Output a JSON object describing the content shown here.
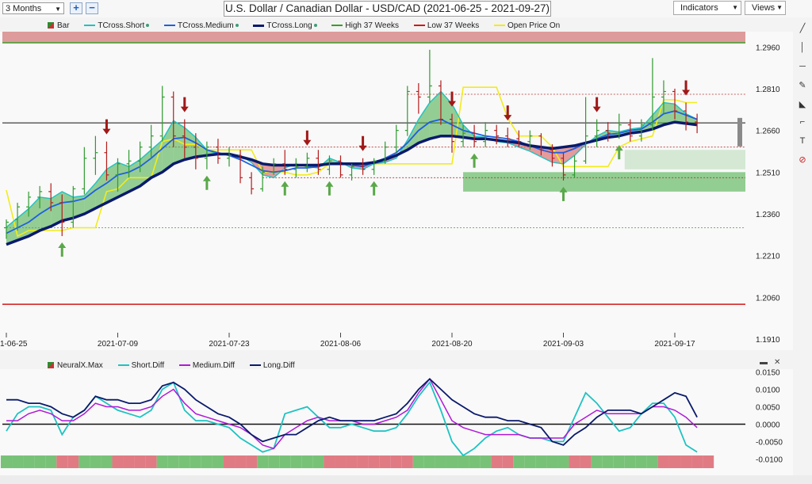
{
  "toolbar": {
    "period": "3 Months",
    "zoom_in": "+",
    "zoom_out": "−",
    "title": "U.S. Dollar / Canadian Dollar - USD/CAD (2021-06-25 - 2021-09-27)",
    "indicators": "Indicators",
    "views": "Views"
  },
  "legend_top": {
    "bar": "Bar",
    "tcross_short": "TCross.Short",
    "tcross_medium": "TCross.Medium",
    "tcross_long": "TCross.Long",
    "high": "High 37 Weeks",
    "low": "Low 37 Weeks",
    "open": "Open Price On"
  },
  "legend_bottom": {
    "neuralx": "NeuralX.Max",
    "short": "Short.Diff",
    "medium": "Medium.Diff",
    "long": "Long.Diff"
  },
  "colors": {
    "tcross_short": "#1fc2c2",
    "tcross_medium": "#1f5fe0",
    "tcross_long": "#0a1a6b",
    "high": "#3a9e2a",
    "low": "#d01818",
    "open": "#f2ec1a",
    "up_bar": "#2f9a2f",
    "down_bar": "#b51c1c",
    "medium_diff": "#b018d8"
  },
  "chart_data": [
    {
      "type": "line",
      "title": "U.S. Dollar / Canadian Dollar - USD/CAD (2021-06-25 - 2021-09-27)",
      "x_tick_labels": [
        "1-06-25",
        "2021-07-09",
        "2021-07-23",
        "2021-08-06",
        "2021-08-20",
        "2021-09-03",
        "2021-09-17"
      ],
      "x_tick_index": [
        0,
        10,
        20,
        30,
        40,
        50,
        60
      ],
      "y_ticks": [
        1.296,
        1.281,
        1.266,
        1.251,
        1.236,
        1.221,
        1.206,
        1.191
      ],
      "y_tick_labels": [
        "1.2960",
        "1.2810",
        "1.2660",
        "1.2510",
        "1.2360",
        "1.2210",
        "1.2060",
        "1.1910"
      ],
      "ylim": [
        1.187,
        1.3015
      ],
      "high_37_weeks": 1.2975,
      "low_37_weeks": 1.2035,
      "last_price": 1.2687,
      "series": [
        {
          "name": "TCross.Short",
          "values": [
            1.2312,
            1.2345,
            1.2378,
            1.242,
            1.2415,
            1.244,
            1.242,
            1.2425,
            1.247,
            1.252,
            1.2545,
            1.253,
            1.2555,
            1.259,
            1.2625,
            1.2695,
            1.267,
            1.2635,
            1.259,
            1.2575,
            1.2575,
            1.257,
            1.2545,
            1.25,
            1.249,
            1.2525,
            1.254,
            1.253,
            1.2525,
            1.256,
            1.2545,
            1.2525,
            1.252,
            1.254,
            1.2545,
            1.256,
            1.2625,
            1.27,
            1.276,
            1.28,
            1.2755,
            1.268,
            1.264,
            1.2635,
            1.262,
            1.2615,
            1.26,
            1.2585,
            1.2565,
            1.2545,
            1.254,
            1.257,
            1.261,
            1.264,
            1.266,
            1.2655,
            1.2665,
            1.267,
            1.2715,
            1.276,
            1.2755,
            1.272,
            1.27
          ]
        },
        {
          "name": "TCross.Medium",
          "values": [
            1.229,
            1.231,
            1.233,
            1.236,
            1.2385,
            1.24,
            1.2405,
            1.2415,
            1.2445,
            1.247,
            1.25,
            1.251,
            1.253,
            1.256,
            1.2595,
            1.263,
            1.2635,
            1.2615,
            1.259,
            1.258,
            1.257,
            1.2555,
            1.2535,
            1.2515,
            1.251,
            1.2515,
            1.2525,
            1.2525,
            1.253,
            1.254,
            1.2545,
            1.2535,
            1.253,
            1.2545,
            1.256,
            1.258,
            1.2615,
            1.266,
            1.269,
            1.27,
            1.268,
            1.266,
            1.265,
            1.264,
            1.2635,
            1.263,
            1.262,
            1.2605,
            1.259,
            1.258,
            1.258,
            1.2595,
            1.2615,
            1.263,
            1.2645,
            1.265,
            1.266,
            1.2665,
            1.269,
            1.272,
            1.273,
            1.2715,
            1.27
          ]
        },
        {
          "name": "TCross.Long",
          "values": [
            1.225,
            1.2265,
            1.228,
            1.23,
            1.2315,
            1.2335,
            1.2345,
            1.236,
            1.238,
            1.24,
            1.242,
            1.244,
            1.246,
            1.249,
            1.251,
            1.254,
            1.2555,
            1.2565,
            1.257,
            1.2575,
            1.2575,
            1.2565,
            1.2555,
            1.254,
            1.2535,
            1.2535,
            1.2535,
            1.2535,
            1.2535,
            1.254,
            1.254,
            1.254,
            1.254,
            1.2545,
            1.2555,
            1.257,
            1.259,
            1.2615,
            1.263,
            1.264,
            1.264,
            1.2635,
            1.263,
            1.263,
            1.2625,
            1.262,
            1.2615,
            1.2605,
            1.26,
            1.2595,
            1.26,
            1.2605,
            1.2615,
            1.2625,
            1.2635,
            1.264,
            1.265,
            1.2655,
            1.2665,
            1.268,
            1.269,
            1.2685,
            1.268
          ]
        },
        {
          "name": "Open Price On",
          "values": [
            1.2445,
            1.228,
            1.23,
            1.23,
            1.23,
            1.23,
            1.231,
            1.231,
            1.231,
            1.244,
            1.245,
            1.249,
            1.249,
            1.249,
            1.262,
            1.263,
            1.261,
            1.261,
            1.259,
            1.259,
            1.259,
            1.259,
            1.259,
            1.251,
            1.251,
            1.251,
            1.25,
            1.25,
            1.251,
            1.254,
            1.254,
            1.254,
            1.254,
            1.254,
            1.254,
            1.254,
            1.254,
            1.254,
            1.254,
            1.254,
            1.254,
            1.2815,
            1.2815,
            1.2815,
            1.2815,
            1.2705,
            1.264,
            1.264,
            1.264,
            1.26,
            1.253,
            1.253,
            1.253,
            1.253,
            1.253,
            1.26,
            1.262,
            1.263,
            1.264,
            1.277,
            1.277,
            1.276,
            1.276
          ]
        },
        {
          "name": "Bar",
          "kind": "ohlc",
          "values": [
            [
              1.231,
              1.234,
              1.227,
              1.233
            ],
            [
              1.234,
              1.24,
              1.23,
              1.2385
            ],
            [
              1.2385,
              1.244,
              1.235,
              1.242
            ],
            [
              1.242,
              1.246,
              1.238,
              1.244
            ],
            [
              1.244,
              1.247,
              1.237,
              1.24
            ],
            [
              1.24,
              1.243,
              1.228,
              1.233
            ],
            [
              1.233,
              1.246,
              1.231,
              1.245
            ],
            [
              1.245,
              1.26,
              1.243,
              1.256
            ],
            [
              1.256,
              1.264,
              1.25,
              1.258
            ],
            [
              1.258,
              1.262,
              1.248,
              1.25
            ],
            [
              1.25,
              1.256,
              1.244,
              1.254
            ],
            [
              1.254,
              1.259,
              1.249,
              1.255
            ],
            [
              1.255,
              1.262,
              1.251,
              1.26
            ],
            [
              1.26,
              1.268,
              1.256,
              1.264
            ],
            [
              1.264,
              1.282,
              1.262,
              1.278
            ],
            [
              1.278,
              1.28,
              1.26,
              1.264
            ],
            [
              1.264,
              1.27,
              1.256,
              1.26
            ],
            [
              1.26,
              1.265,
              1.252,
              1.256
            ],
            [
              1.256,
              1.262,
              1.252,
              1.26
            ],
            [
              1.26,
              1.263,
              1.254,
              1.256
            ],
            [
              1.256,
              1.26,
              1.253,
              1.257
            ],
            [
              1.257,
              1.259,
              1.247,
              1.249
            ],
            [
              1.249,
              1.251,
              1.243,
              1.245
            ],
            [
              1.245,
              1.253,
              1.244,
              1.251
            ],
            [
              1.251,
              1.256,
              1.25,
              1.254
            ],
            [
              1.254,
              1.259,
              1.25,
              1.252
            ],
            [
              1.252,
              1.256,
              1.249,
              1.253
            ],
            [
              1.253,
              1.258,
              1.251,
              1.256
            ],
            [
              1.256,
              1.259,
              1.25,
              1.252
            ],
            [
              1.252,
              1.257,
              1.25,
              1.255
            ],
            [
              1.255,
              1.257,
              1.249,
              1.25
            ],
            [
              1.25,
              1.254,
              1.248,
              1.253
            ],
            [
              1.253,
              1.256,
              1.25,
              1.252
            ],
            [
              1.252,
              1.256,
              1.25,
              1.255
            ],
            [
              1.255,
              1.262,
              1.254,
              1.26
            ],
            [
              1.26,
              1.268,
              1.258,
              1.266
            ],
            [
              1.266,
              1.282,
              1.264,
              1.28
            ],
            [
              1.28,
              1.283,
              1.272,
              1.278
            ],
            [
              1.278,
              1.295,
              1.276,
              1.282
            ],
            [
              1.282,
              1.284,
              1.268,
              1.27
            ],
            [
              1.27,
              1.272,
              1.258,
              1.262
            ],
            [
              1.262,
              1.268,
              1.26,
              1.265
            ],
            [
              1.265,
              1.268,
              1.26,
              1.262
            ],
            [
              1.262,
              1.269,
              1.26,
              1.266
            ],
            [
              1.266,
              1.268,
              1.261,
              1.264
            ],
            [
              1.264,
              1.267,
              1.26,
              1.263
            ],
            [
              1.263,
              1.266,
              1.26,
              1.262
            ],
            [
              1.262,
              1.266,
              1.259,
              1.264
            ],
            [
              1.264,
              1.265,
              1.257,
              1.259
            ],
            [
              1.259,
              1.261,
              1.253,
              1.256
            ],
            [
              1.256,
              1.258,
              1.248,
              1.25
            ],
            [
              1.25,
              1.257,
              1.249,
              1.255
            ],
            [
              1.255,
              1.278,
              1.254,
              1.264
            ],
            [
              1.264,
              1.27,
              1.26,
              1.266
            ],
            [
              1.266,
              1.269,
              1.262,
              1.265
            ],
            [
              1.265,
              1.272,
              1.263,
              1.268
            ],
            [
              1.268,
              1.27,
              1.262,
              1.264
            ],
            [
              1.264,
              1.27,
              1.262,
              1.268
            ],
            [
              1.268,
              1.292,
              1.266,
              1.278
            ],
            [
              1.278,
              1.284,
              1.272,
              1.28
            ],
            [
              1.28,
              1.281,
              1.27,
              1.273
            ],
            [
              1.273,
              1.276,
              1.266,
              1.269
            ],
            [
              1.269,
              1.272,
              1.265,
              1.2687
            ]
          ]
        }
      ]
    },
    {
      "type": "line",
      "x_tick_index": [
        0,
        10,
        20,
        30,
        40,
        50,
        60
      ],
      "y_ticks": [
        0.015,
        0.01,
        0.005,
        0.0,
        -0.005,
        -0.01
      ],
      "y_tick_labels": [
        "0.0150",
        "0.0100",
        "0.0050",
        "0.0000",
        "-0.0050",
        "-0.0100"
      ],
      "ylim": [
        -0.0115,
        0.0158
      ],
      "series": [
        {
          "name": "Short.Diff",
          "values": [
            -0.002,
            0.003,
            0.005,
            0.005,
            0.004,
            -0.003,
            0.002,
            0.004,
            0.008,
            0.006,
            0.004,
            0.003,
            0.002,
            0.004,
            0.01,
            0.012,
            0.004,
            0.001,
            0.001,
            0.0,
            -0.001,
            -0.004,
            -0.006,
            -0.008,
            -0.007,
            0.003,
            0.004,
            0.005,
            0.002,
            -0.001,
            -0.001,
            0.0,
            -0.001,
            -0.002,
            -0.002,
            -0.001,
            0.003,
            0.008,
            0.012,
            0.004,
            -0.005,
            -0.009,
            -0.007,
            -0.004,
            -0.002,
            -0.001,
            -0.003,
            -0.004,
            -0.004,
            -0.005,
            -0.005,
            0.002,
            0.009,
            0.006,
            0.002,
            -0.002,
            -0.001,
            0.003,
            0.006,
            0.006,
            0.002,
            -0.006,
            -0.008
          ]
        },
        {
          "name": "Medium.Diff",
          "values": [
            0.001,
            0.001,
            0.003,
            0.004,
            0.003,
            0.001,
            0.001,
            0.003,
            0.006,
            0.005,
            0.005,
            0.004,
            0.004,
            0.005,
            0.008,
            0.01,
            0.006,
            0.003,
            0.002,
            0.001,
            0.0,
            -0.001,
            -0.003,
            -0.006,
            -0.007,
            -0.003,
            -0.001,
            0.001,
            0.002,
            0.001,
            0.001,
            0.001,
            0.0,
            0.0,
            0.001,
            0.002,
            0.004,
            0.009,
            0.013,
            0.007,
            0.001,
            -0.001,
            -0.002,
            -0.003,
            -0.003,
            -0.003,
            -0.003,
            -0.004,
            -0.004,
            -0.004,
            -0.004,
            0.0,
            0.002,
            0.004,
            0.003,
            0.003,
            0.003,
            0.003,
            0.005,
            0.005,
            0.004,
            0.002,
            -0.001
          ]
        },
        {
          "name": "Long.Diff",
          "values": [
            0.007,
            0.007,
            0.006,
            0.006,
            0.005,
            0.003,
            0.002,
            0.004,
            0.008,
            0.007,
            0.007,
            0.006,
            0.006,
            0.007,
            0.011,
            0.012,
            0.01,
            0.007,
            0.005,
            0.003,
            0.002,
            0.0,
            -0.003,
            -0.005,
            -0.004,
            -0.003,
            -0.003,
            -0.001,
            0.001,
            0.002,
            0.001,
            0.001,
            0.001,
            0.001,
            0.002,
            0.003,
            0.006,
            0.01,
            0.013,
            0.01,
            0.007,
            0.005,
            0.003,
            0.002,
            0.002,
            0.001,
            0.001,
            0.0,
            -0.001,
            -0.005,
            -0.006,
            -0.003,
            -0.001,
            0.002,
            0.004,
            0.004,
            0.004,
            0.003,
            0.005,
            0.007,
            0.009,
            0.008,
            0.002
          ]
        },
        {
          "name": "NeuralX.Max",
          "kind": "strip",
          "values": [
            1,
            1,
            1,
            1,
            1,
            0,
            0,
            1,
            1,
            1,
            0,
            0,
            0,
            0,
            1,
            1,
            1,
            1,
            1,
            1,
            0,
            0,
            0,
            1,
            1,
            1,
            1,
            1,
            1,
            0,
            0,
            0,
            0,
            0,
            0,
            0,
            0,
            1,
            1,
            1,
            1,
            1,
            1,
            1,
            0,
            0,
            1,
            1,
            1,
            1,
            1,
            0,
            0,
            1,
            1,
            1,
            1,
            1,
            1,
            0,
            0,
            0,
            0,
            0
          ]
        }
      ]
    }
  ]
}
